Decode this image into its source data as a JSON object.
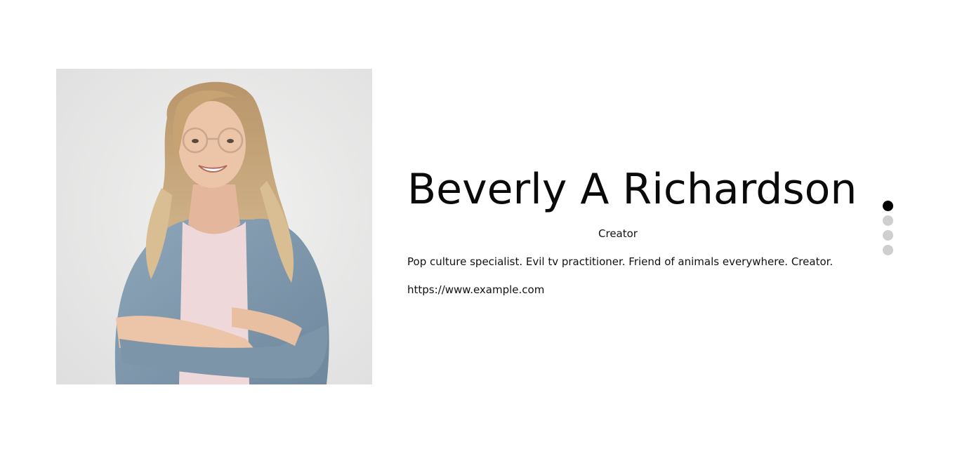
{
  "profile": {
    "photo_alt": "Portrait photo",
    "name": "Beverly A Richardson",
    "role": "Creator",
    "bio": "Pop culture specialist. Evil tv practitioner. Friend of animals everywhere. Creator.",
    "website": "https://www.example.com"
  },
  "carousel": {
    "slide_count": 4,
    "active_index": 0
  },
  "colors": {
    "background": "#ffffff",
    "text": "#111111",
    "dot_active": "#000000",
    "dot_inactive": "#cfcfcf"
  }
}
